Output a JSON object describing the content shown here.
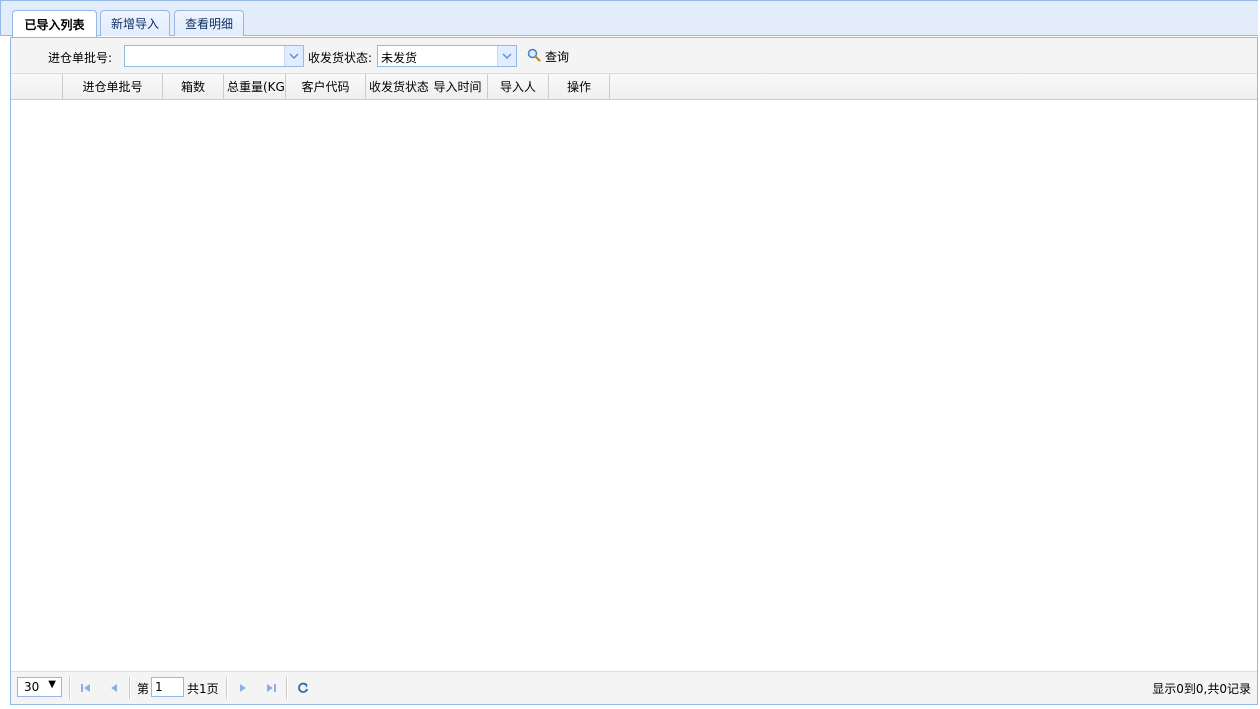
{
  "tabs": [
    {
      "label": "已导入列表",
      "selected": true
    },
    {
      "label": "新增导入",
      "selected": false
    },
    {
      "label": "查看明细",
      "selected": false
    }
  ],
  "toolbar": {
    "batch_label": "进仓单批号:",
    "batch_value": "",
    "status_label": "收发货状态:",
    "status_value": "未发货",
    "search_label": "查询"
  },
  "grid": {
    "columns": [
      "进仓单批号",
      "箱数",
      "总重量(KG",
      "客户代码",
      "收发货状态",
      "导入时间",
      "导入人",
      "操作"
    ],
    "rows": []
  },
  "pager": {
    "page_size": "30",
    "page_prefix": "第",
    "page_number": "1",
    "page_total": "共1页",
    "info": "显示0到0,共0记录"
  },
  "colors": {
    "accent_border": "#95b8e7",
    "tab_bar_bg": "#e3edf9",
    "nav_icon": "#8db2e3"
  }
}
